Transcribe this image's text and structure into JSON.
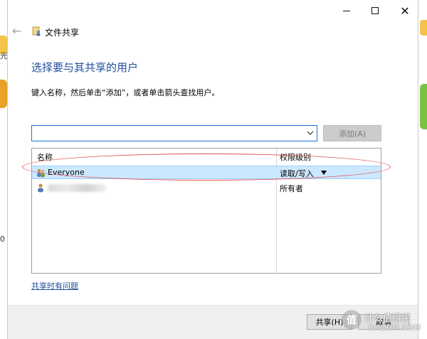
{
  "desktop": {
    "left_label_1": "光",
    "left_label_2": "0"
  },
  "window": {
    "title": "文件共享",
    "min_icon": "minimize-icon",
    "max_icon": "maximize-icon",
    "close_icon": "close-icon",
    "close_glyph": "✕"
  },
  "nav": {
    "back_glyph": "←"
  },
  "main": {
    "heading": "选择要与其共享的用户",
    "instruction": "键入名称，然后单击“添加”，或者单击箭头查找用户。",
    "name_input_value": "",
    "add_button": "添加(A)"
  },
  "list": {
    "columns": [
      "名称",
      "权限级别"
    ],
    "rows": [
      {
        "name": "Everyone",
        "permission": "读取/写入",
        "selected": true,
        "icon": "users-group-icon"
      },
      {
        "name": "",
        "permission": "所有者",
        "selected": false,
        "icon": "user-icon"
      }
    ]
  },
  "help": {
    "link": "共享时有问题"
  },
  "footer": {
    "share_button": "共享(H)",
    "cancel_button": "取消"
  },
  "watermark": {
    "glyph": "值",
    "text": "什么值得买",
    "sub": "SMZDM.COM"
  },
  "colors": {
    "accent": "#1f4ea0",
    "selection": "#cce8ff",
    "annotation": "#e05050"
  }
}
